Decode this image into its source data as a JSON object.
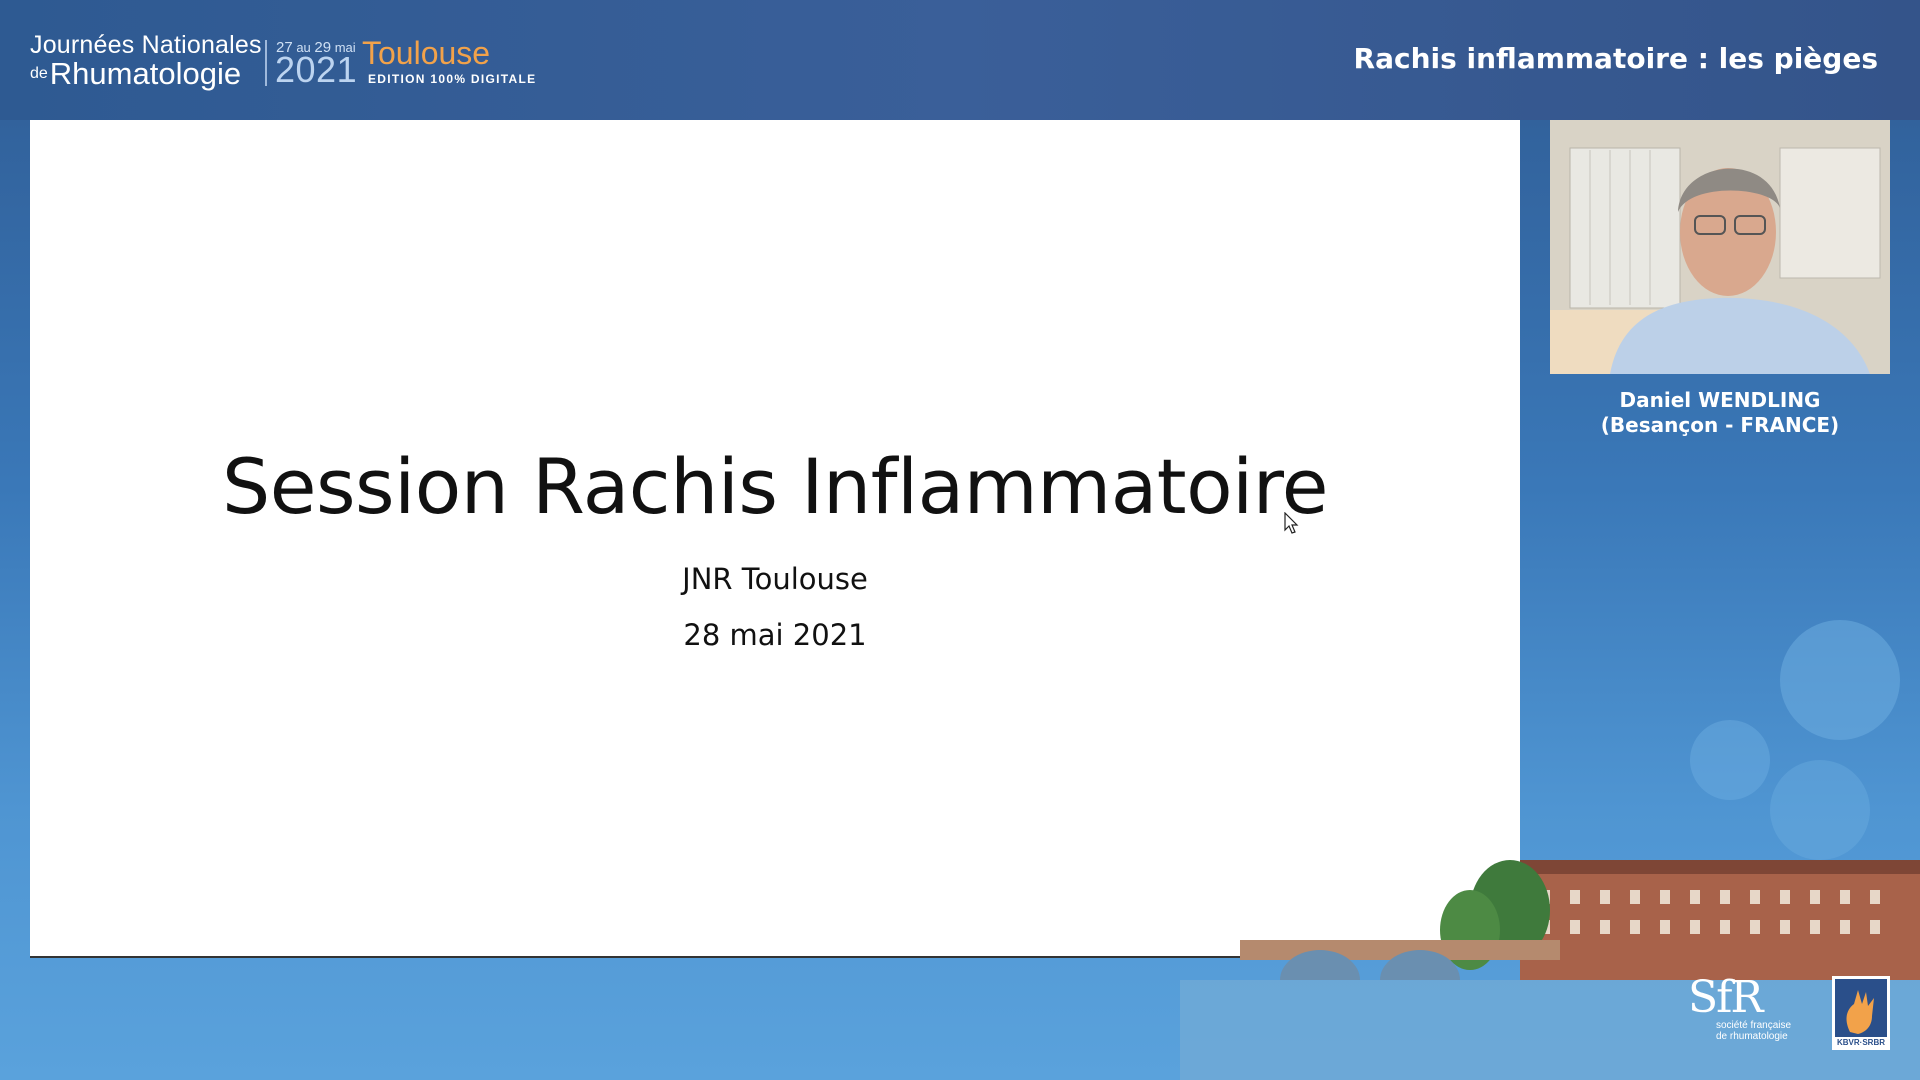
{
  "header": {
    "logo": {
      "line1": "Journées Nationales",
      "de": "de",
      "line2": "Rhumatologie",
      "dates_from": "27",
      "dates_au": "au",
      "dates_to": "29",
      "dates_month": "mai",
      "year": "2021",
      "city": "Toulouse",
      "edition": "EDITION 100% DIGITALE"
    },
    "talk_title": "Rachis inflammatoire : les pièges"
  },
  "slide": {
    "title": "Session Rachis Inflammatoire",
    "line1": "JNR Toulouse",
    "line2": "28 mai 2021"
  },
  "speaker": {
    "name": "Daniel WENDLING",
    "location": "(Besançon - FRANCE)"
  },
  "footer": {
    "sfr_logo": "SfR",
    "sfr_line1": "société française",
    "sfr_line2": "de rhumatologie",
    "kbvr_label": "KBVR·SRBR"
  },
  "colors": {
    "header_bg": "#3a5f99",
    "accent_orange": "#f2a24a",
    "slide_bg": "#ffffff"
  }
}
